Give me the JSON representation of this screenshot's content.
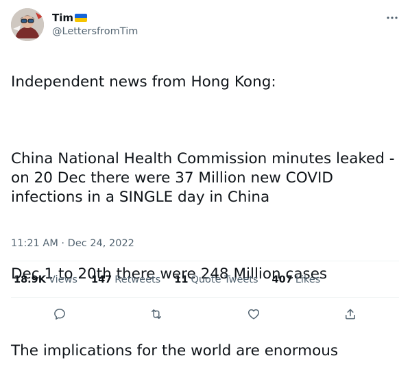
{
  "author": {
    "name": "Tim",
    "handle": "@LettersfromTim",
    "flag_colors": [
      "#1565d8",
      "#f5c400"
    ],
    "avatar_icon": "avatar-illustration"
  },
  "tweet": {
    "line1": "Independent news from Hong Kong:",
    "line2": "China National Health Commission minutes leaked - on 20 Dec there were 37 Million new COVID infections in a SINGLE day in China",
    "line3": "Dec 1 to 20th there were 248 Million cases",
    "line4": "The implications for the world are enormous"
  },
  "timestamp": "11:21 AM · Dec 24, 2022",
  "stats": {
    "views_count": "18.9K",
    "views_label": "Views",
    "retweets_count": "147",
    "retweets_label": "Retweets",
    "quotes_count": "11",
    "quotes_label": "Quote Tweets",
    "likes_count": "407",
    "likes_label": "Likes"
  },
  "actions": {
    "reply_icon": "reply-icon",
    "retweet_icon": "retweet-icon",
    "like_icon": "heart-icon",
    "share_icon": "share-icon"
  },
  "colors": {
    "text": "#0f1419",
    "secondary": "#536471",
    "divider": "#eff3f4"
  }
}
